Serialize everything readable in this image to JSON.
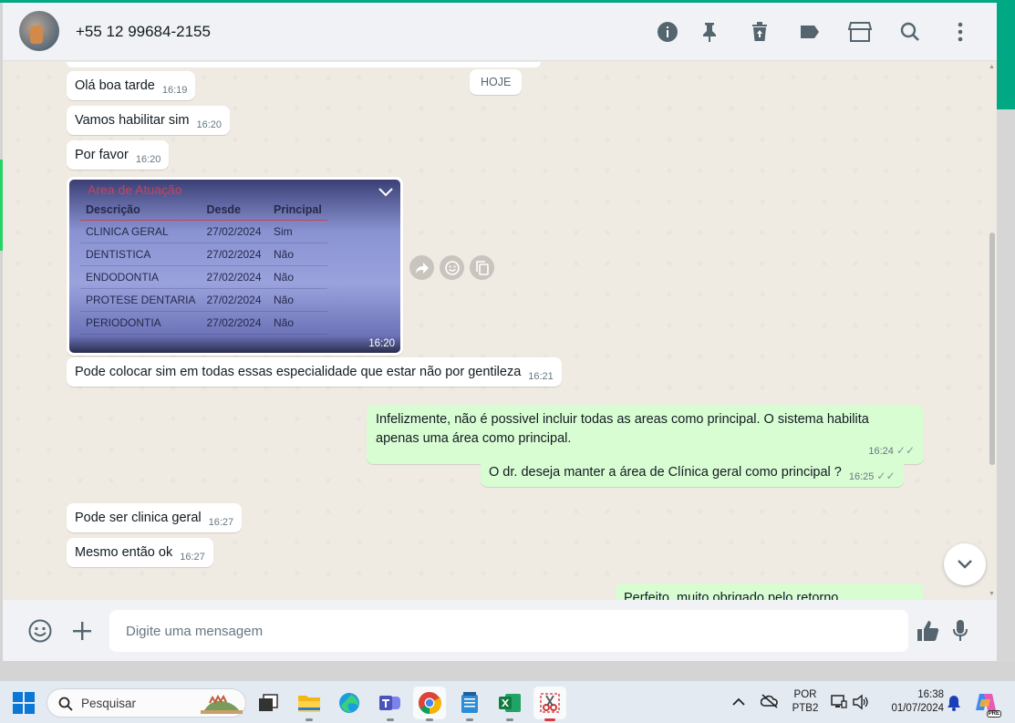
{
  "header": {
    "contact_name": "+55 12 99684-2155"
  },
  "chat": {
    "date_chip": "HOJE",
    "messages": [
      {
        "text": "Olá boa tarde",
        "time": "16:19"
      },
      {
        "text": "Vamos habilitar sim",
        "time": "16:20"
      },
      {
        "text": "Por favor",
        "time": "16:20"
      },
      {
        "text": "Pode colocar sim em todas essas especialidade que estar não por gentileza",
        "time": "16:21"
      },
      {
        "text": "Infelizmente, não é possivel incluir todas as areas como principal. O sistema habilita",
        "text2": "apenas uma área como principal.",
        "time": "16:24"
      },
      {
        "text": "O dr. deseja manter a área de Clínica geral como principal ?",
        "time": "16:25"
      },
      {
        "text": "Pode ser clinica geral",
        "time": "16:27"
      },
      {
        "text": "Mesmo então ok",
        "time": "16:27"
      },
      {
        "text": "Perfeito, muito obrigado pelo retorno"
      }
    ],
    "image": {
      "title": "Area de Atuação",
      "headers": [
        "Descrição",
        "Desde",
        "Principal"
      ],
      "rows": [
        [
          "CLINICA GERAL",
          "27/02/2024",
          "Sim"
        ],
        [
          "DENTISTICA",
          "27/02/2024",
          "Não"
        ],
        [
          "ENDODONTIA",
          "27/02/2024",
          "Não"
        ],
        [
          "PROTESE DENTARIA",
          "27/02/2024",
          "Não"
        ],
        [
          "PERIODONTIA",
          "27/02/2024",
          "Não"
        ]
      ],
      "time": "16:20"
    }
  },
  "compose": {
    "placeholder": "Digite uma mensagem"
  },
  "taskbar": {
    "search_placeholder": "Pesquisar",
    "lang_line1": "POR",
    "lang_line2": "PTB2",
    "clock_time": "16:38",
    "clock_date": "01/07/2024",
    "copilot_badge": "PRE"
  },
  "colors": {
    "accent": "#00a884",
    "outgoing_bubble": "#d9fdd3",
    "incoming_bubble": "#ffffff",
    "chat_bg": "#efeae2"
  }
}
